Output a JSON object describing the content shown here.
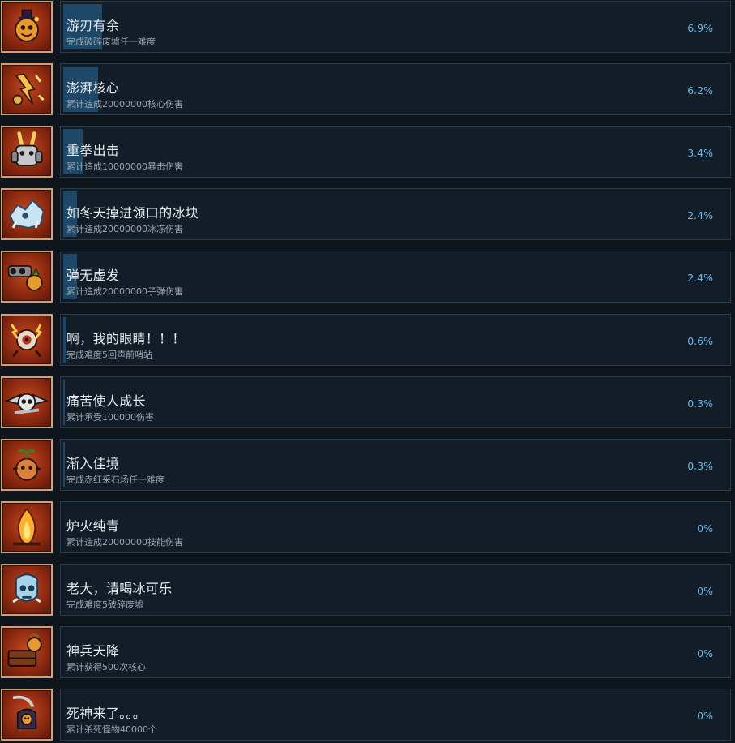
{
  "achievements": [
    {
      "title": "游刃有余",
      "desc": "完成破碎废墟任一难度",
      "percent": "6.9%",
      "progress": 6.9,
      "icon": "cookie-mascot-icon"
    },
    {
      "title": "澎湃核心",
      "desc": "累计造成20000000核心伤害",
      "percent": "6.2%",
      "progress": 6.2,
      "icon": "electric-core-icon"
    },
    {
      "title": "重拳出击",
      "desc": "累计造成10000000暴击伤害",
      "percent": "3.4%",
      "progress": 3.4,
      "icon": "armored-bunny-icon"
    },
    {
      "title": "如冬天掉进领口的冰块",
      "desc": "累计造成20000000冰冻伤害",
      "percent": "2.4%",
      "progress": 2.4,
      "icon": "frozen-creature-icon"
    },
    {
      "title": "弹无虚发",
      "desc": "累计造成20000000子弹伤害",
      "percent": "2.4%",
      "progress": 2.4,
      "icon": "gunner-icon"
    },
    {
      "title": "啊，我的眼睛！！！",
      "desc": "完成难度5回声前哨站",
      "percent": "0.6%",
      "progress": 0.6,
      "icon": "eye-monster-icon"
    },
    {
      "title": "痛苦使人成长",
      "desc": "累计承受100000伤害",
      "percent": "0.3%",
      "progress": 0.3,
      "icon": "winged-skull-icon"
    },
    {
      "title": "渐入佳境",
      "desc": "完成赤红采石场任一难度",
      "percent": "0.3%",
      "progress": 0.3,
      "icon": "sprout-creature-icon"
    },
    {
      "title": "炉火纯青",
      "desc": "累计造成20000000技能伤害",
      "percent": "0%",
      "progress": 0,
      "icon": "flame-icon"
    },
    {
      "title": "老大，请喝冰可乐",
      "desc": "完成难度5破碎废墟",
      "percent": "0%",
      "progress": 0,
      "icon": "ice-skull-icon"
    },
    {
      "title": "神兵天降",
      "desc": "累计获得500次核心",
      "percent": "0%",
      "progress": 0,
      "icon": "supply-crate-icon"
    },
    {
      "title": "死神来了。。。",
      "desc": "累计杀死怪物40000个",
      "percent": "0%",
      "progress": 0,
      "icon": "reaper-icon"
    }
  ],
  "colors": {
    "background": "#0f151d",
    "panel": "#121d28",
    "progress": "#1e4868",
    "percent_text": "#66b8ec",
    "icon_bg": "#a33a16"
  }
}
